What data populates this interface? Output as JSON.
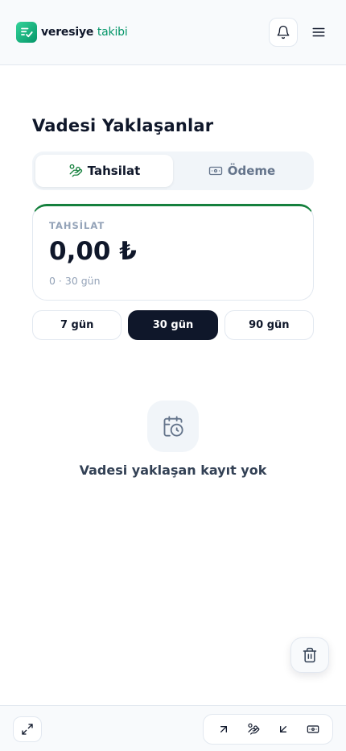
{
  "header": {
    "brand_main": "veresiye",
    "brand_accent": "takibi",
    "icons": [
      "logo-check-icon",
      "bell-icon",
      "hamburger-menu-icon"
    ]
  },
  "page": {
    "title": "Vadesi Yaklaşanlar"
  },
  "segment": {
    "tabs": [
      {
        "label": "Tahsilat",
        "icon": "hand-coins-icon",
        "active": true
      },
      {
        "label": "Ödeme",
        "icon": "banknote-icon",
        "active": false
      }
    ]
  },
  "summary": {
    "label": "TAHSİLAT",
    "amount": "0,00 ₺",
    "range_text": "0 · 30 gün",
    "accent_color": "#15803d"
  },
  "ranges": [
    {
      "label": "7 gün",
      "active": false
    },
    {
      "label": "30 gün",
      "active": true
    },
    {
      "label": "90 gün",
      "active": false
    }
  ],
  "empty_state": {
    "icon": "calendar-clock-icon",
    "message": "Vadesi yaklaşan kayıt yok"
  },
  "floating": {
    "icon": "trash-icon"
  },
  "bottom_bar": {
    "icons": [
      "expand-icon",
      "arrow-up-right-icon",
      "hand-coins-icon",
      "arrow-down-left-icon",
      "banknote-icon"
    ]
  },
  "colors": {
    "brand_green": "#059669",
    "dark": "#0f172a",
    "muted": "#94a3b8"
  }
}
